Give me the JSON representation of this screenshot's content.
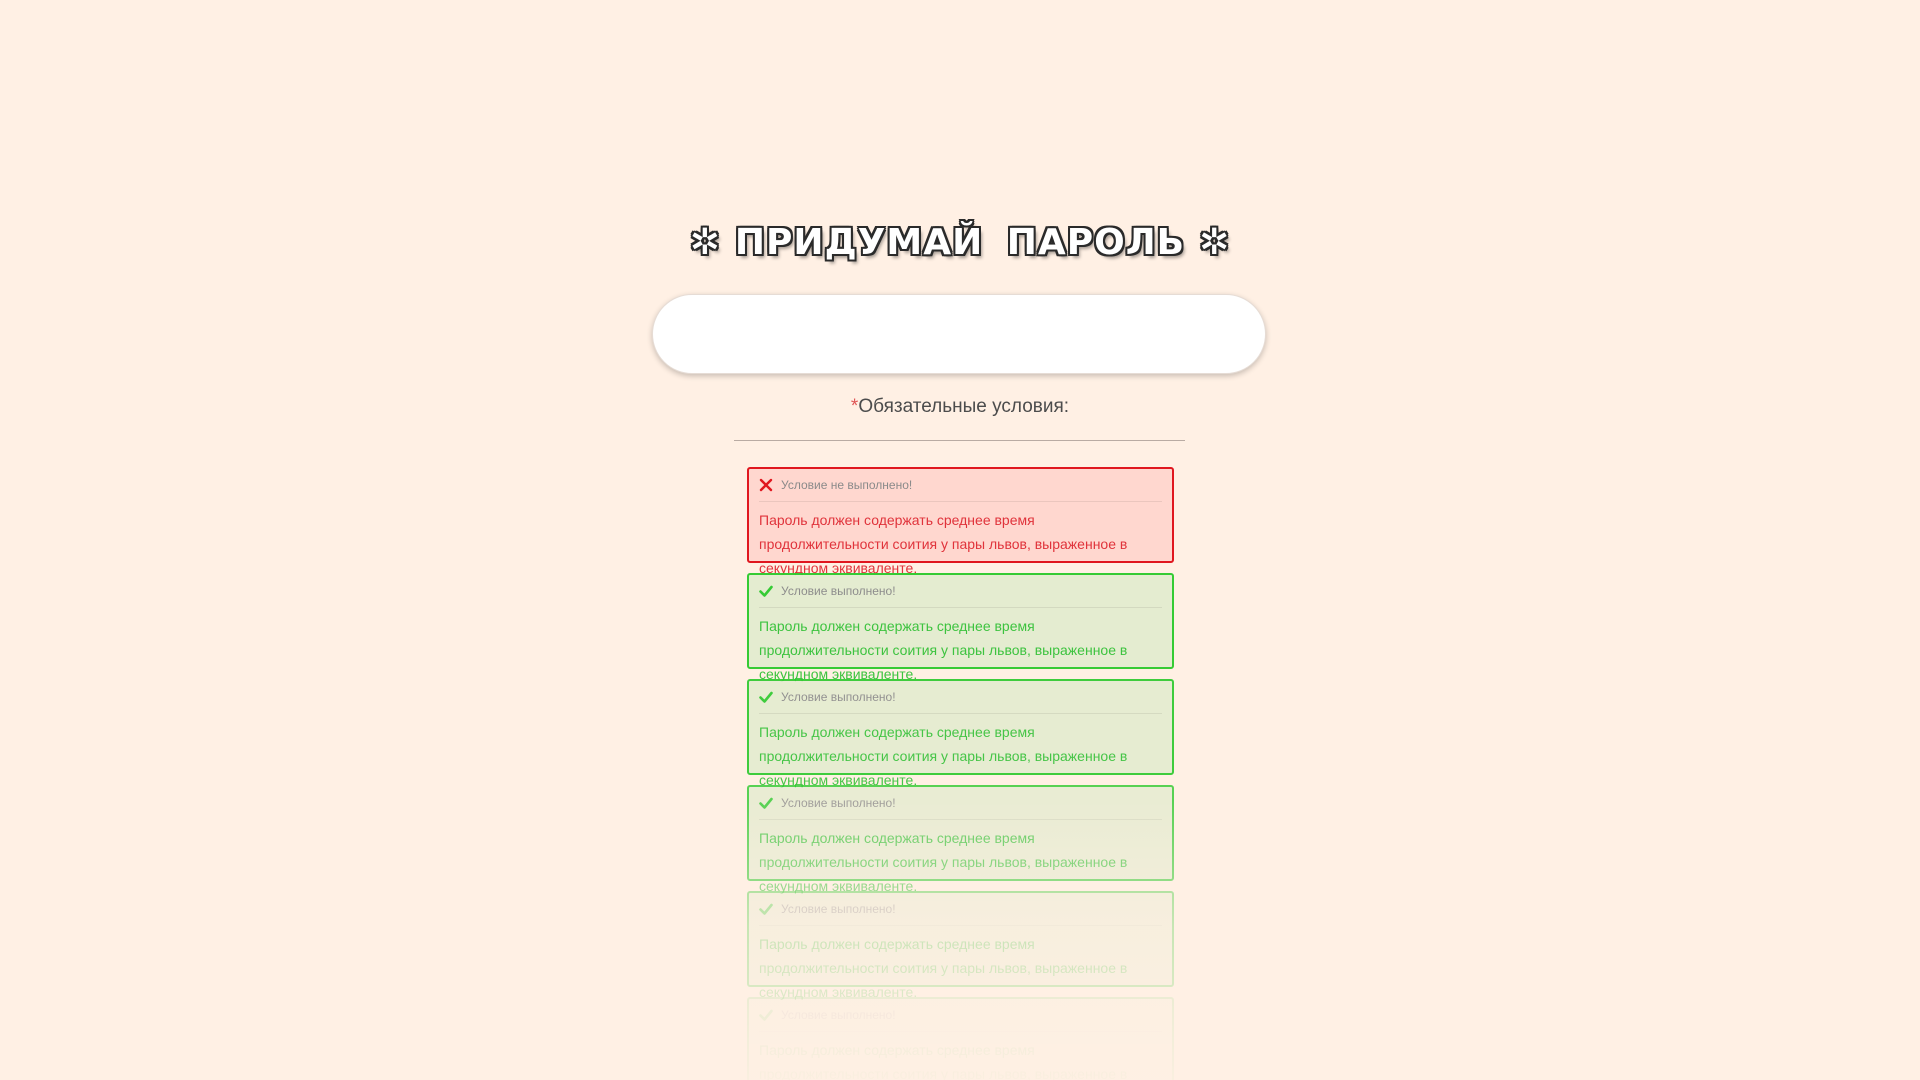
{
  "header": {
    "star_left": "✲",
    "title": "ПРИДУМАЙ ПАРОЛЬ",
    "star_right": "✲"
  },
  "password": {
    "value": "",
    "placeholder": ""
  },
  "conditions": {
    "required_mark": "*",
    "heading": "Обязательные условия:"
  },
  "colors": {
    "fail_border": "#e0171f",
    "fail_bg": "#ffd7cf",
    "ok_border": "#2fca2f",
    "ok_bg": "#e4ecd0",
    "background": "#fff0e4"
  },
  "rules": [
    {
      "status": "Условие не выполнено!",
      "state": "fail",
      "icon": "cross-icon",
      "text": "Пароль должен содержать среднее время продолжительности соития у пары львов, выраженное в секундном эквиваленте."
    },
    {
      "status": "Условие выполнено!",
      "state": "ok",
      "icon": "check-icon",
      "text": "Пароль должен содержать среднее время продолжительности соития у пары львов, выраженное в секундном эквиваленте."
    },
    {
      "status": "Условие выполнено!",
      "state": "ok",
      "icon": "check-icon",
      "text": "Пароль должен содержать среднее время продолжительности соития у пары львов, выраженное в секундном эквиваленте."
    },
    {
      "status": "Условие выполнено!",
      "state": "ok",
      "icon": "check-icon",
      "text": "Пароль должен содержать среднее время продолжительности соития у пары львов, выраженное в секундном эквиваленте."
    },
    {
      "status": "Условие выполнено!",
      "state": "ok",
      "icon": "check-icon",
      "text": "Пароль должен содержать среднее время продолжительности соития у пары львов, выраженное в секундном эквиваленте."
    },
    {
      "status": "Условие выполнено!",
      "state": "ok",
      "icon": "check-icon",
      "text": "Пароль должен содержать среднее время продолжительности соития у пары львов, выраженное в секундном эквиваленте."
    }
  ]
}
